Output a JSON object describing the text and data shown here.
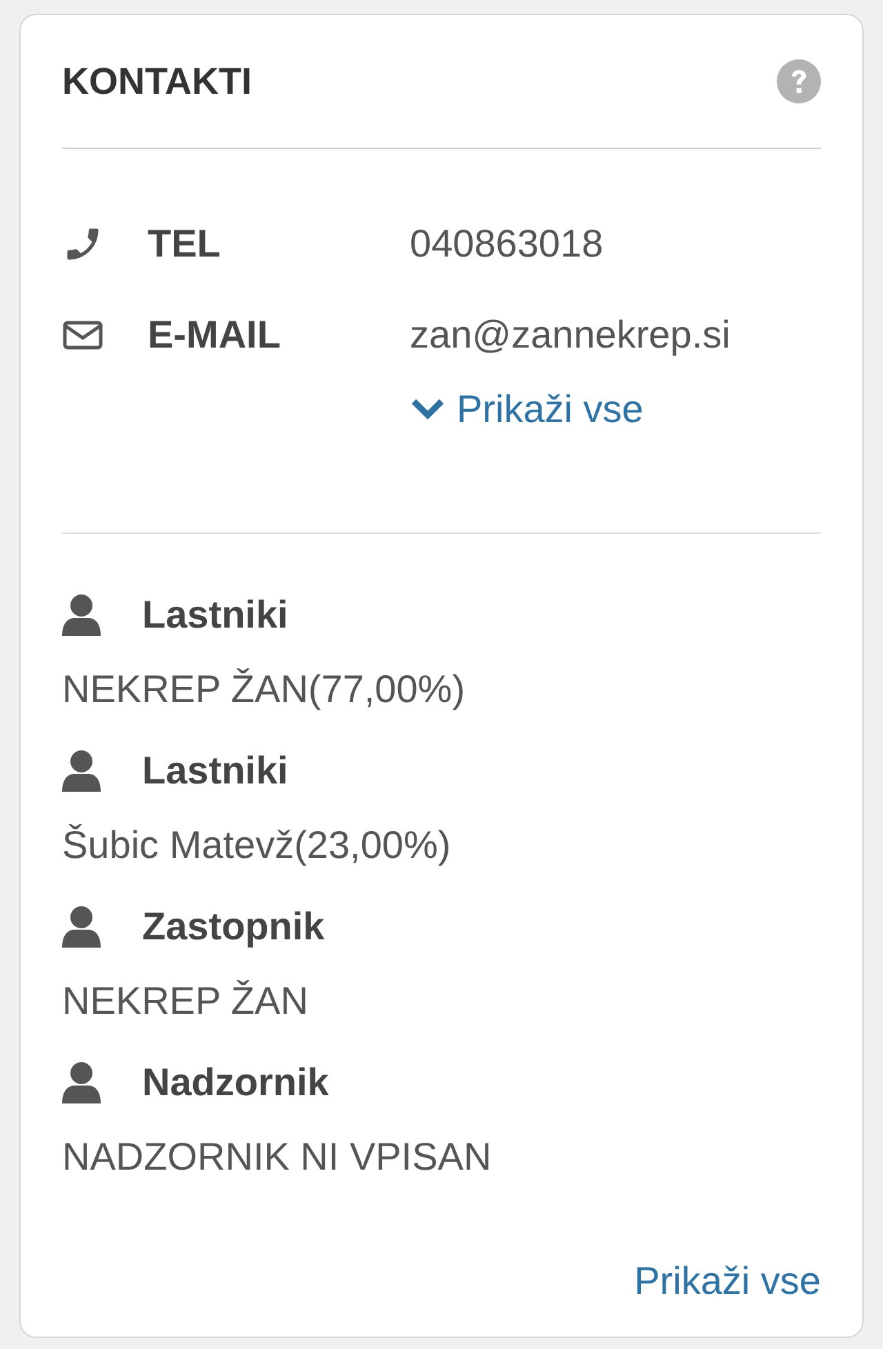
{
  "card": {
    "title": "KONTAKTI",
    "contacts": [
      {
        "kind": "phone",
        "label": "TEL",
        "value": "040863018"
      },
      {
        "kind": "email",
        "label": "E-MAIL",
        "value": "zan@zannekrep.si"
      }
    ],
    "contacts_more": "Prikaži vse",
    "people": [
      {
        "role": "Lastniki",
        "name": "NEKREP ŽAN(77,00%)"
      },
      {
        "role": "Lastniki",
        "name": "Šubic Matevž(23,00%)"
      },
      {
        "role": "Zastopnik",
        "name": "NEKREP ŽAN"
      },
      {
        "role": "Nadzornik",
        "name": "NADZORNIK NI VPISAN"
      }
    ],
    "people_more": "Prikaži vse"
  }
}
